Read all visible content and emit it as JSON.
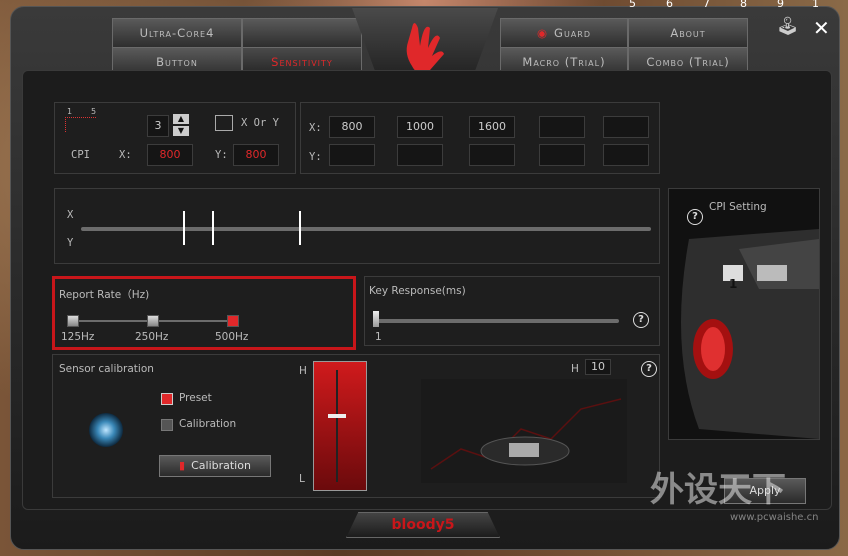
{
  "top_numbers": [
    "5",
    "6",
    "7",
    "8",
    "9",
    "1"
  ],
  "tabs": {
    "ultra_core": "Ultra-Core4",
    "button": "Button",
    "sensitivity": "Sensitivity",
    "guard": "Guard",
    "about": "About",
    "macro": "Macro (Trial)",
    "combo": "Combo (Trial)"
  },
  "cpi_panel": {
    "level_left": "1",
    "level_right": "5",
    "level_value": "3",
    "xory_label": "X Or Y",
    "cpi_label": "CPI",
    "x_label": "X:",
    "y_label": "Y:",
    "x_value": "800",
    "y_value": "800"
  },
  "cpi_table": {
    "x_label": "X:",
    "y_label": "Y:",
    "x_values": [
      "800",
      "1000",
      "1600",
      "",
      ""
    ],
    "y_values": [
      "",
      "",
      "",
      "",
      ""
    ]
  },
  "slider_panel": {
    "x_label": "X",
    "y_label": "Y"
  },
  "report_rate": {
    "title": "Report Rate（Hz)",
    "options": [
      "125Hz",
      "250Hz",
      "500Hz"
    ],
    "selected": "500Hz"
  },
  "key_response": {
    "title": "Key  Response(ms)",
    "value": "1"
  },
  "sensor": {
    "title": "Sensor calibration",
    "preset": "Preset",
    "calibration": "Calibration",
    "button": "Calibration",
    "h_label": "H",
    "l_label": "L",
    "h_value": "10"
  },
  "cpi_setting": {
    "title": "CPI Setting",
    "badge": "1"
  },
  "apply_label": "Apply",
  "bottom_logo": "bloody5",
  "watermark": "外设天下",
  "watermark_url": "www.pcwaishe.cn",
  "colors": {
    "accent": "#e0282a",
    "panel": "#1c1c1c",
    "frame": "#2a2a2a"
  }
}
